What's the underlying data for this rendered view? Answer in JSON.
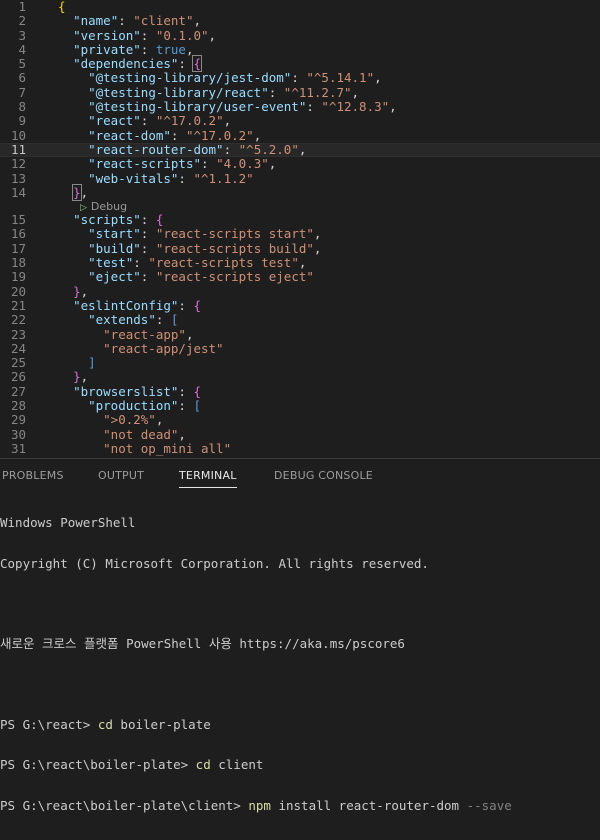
{
  "editor": {
    "codelens": "Debug",
    "lines": [
      {
        "n": "1",
        "parts": [
          {
            "t": "{",
            "c": "y"
          }
        ]
      },
      {
        "n": "2",
        "parts": [
          {
            "t": "  "
          },
          {
            "t": "\"name\"",
            "c": "k"
          },
          {
            "t": ": "
          },
          {
            "t": "\"client\"",
            "c": "s"
          },
          {
            "t": ","
          }
        ]
      },
      {
        "n": "3",
        "parts": [
          {
            "t": "  "
          },
          {
            "t": "\"version\"",
            "c": "k"
          },
          {
            "t": ": "
          },
          {
            "t": "\"0.1.0\"",
            "c": "s"
          },
          {
            "t": ","
          }
        ]
      },
      {
        "n": "4",
        "parts": [
          {
            "t": "  "
          },
          {
            "t": "\"private\"",
            "c": "k"
          },
          {
            "t": ": "
          },
          {
            "t": "true",
            "c": "b"
          },
          {
            "t": ","
          }
        ]
      },
      {
        "n": "5",
        "parts": [
          {
            "t": "  "
          },
          {
            "t": "\"dependencies\"",
            "c": "k"
          },
          {
            "t": ": "
          },
          {
            "t": "{",
            "c": "m",
            "hl": true
          }
        ]
      },
      {
        "n": "6",
        "parts": [
          {
            "t": "    "
          },
          {
            "t": "\"@testing-library/jest-dom\"",
            "c": "k"
          },
          {
            "t": ": "
          },
          {
            "t": "\"^5.14.1\"",
            "c": "s"
          },
          {
            "t": ","
          }
        ]
      },
      {
        "n": "7",
        "parts": [
          {
            "t": "    "
          },
          {
            "t": "\"@testing-library/react\"",
            "c": "k"
          },
          {
            "t": ": "
          },
          {
            "t": "\"^11.2.7\"",
            "c": "s"
          },
          {
            "t": ","
          }
        ]
      },
      {
        "n": "8",
        "parts": [
          {
            "t": "    "
          },
          {
            "t": "\"@testing-library/user-event\"",
            "c": "k"
          },
          {
            "t": ": "
          },
          {
            "t": "\"^12.8.3\"",
            "c": "s"
          },
          {
            "t": ","
          }
        ]
      },
      {
        "n": "9",
        "parts": [
          {
            "t": "    "
          },
          {
            "t": "\"react\"",
            "c": "k"
          },
          {
            "t": ": "
          },
          {
            "t": "\"^17.0.2\"",
            "c": "s"
          },
          {
            "t": ","
          }
        ]
      },
      {
        "n": "10",
        "parts": [
          {
            "t": "    "
          },
          {
            "t": "\"react-dom\"",
            "c": "k"
          },
          {
            "t": ": "
          },
          {
            "t": "\"^17.0.2\"",
            "c": "s"
          },
          {
            "t": ","
          }
        ]
      },
      {
        "n": "11",
        "current": true,
        "parts": [
          {
            "t": "    "
          },
          {
            "t": "\"react-router-dom\"",
            "c": "k"
          },
          {
            "t": ": "
          },
          {
            "t": "\"^5.2.0\"",
            "c": "s"
          },
          {
            "t": ","
          }
        ]
      },
      {
        "n": "12",
        "parts": [
          {
            "t": "    "
          },
          {
            "t": "\"react-scripts\"",
            "c": "k"
          },
          {
            "t": ": "
          },
          {
            "t": "\"4.0.3\"",
            "c": "s"
          },
          {
            "t": ","
          }
        ]
      },
      {
        "n": "13",
        "parts": [
          {
            "t": "    "
          },
          {
            "t": "\"web-vitals\"",
            "c": "k"
          },
          {
            "t": ": "
          },
          {
            "t": "\"^1.1.2\"",
            "c": "s"
          }
        ]
      },
      {
        "n": "14",
        "parts": [
          {
            "t": "  "
          },
          {
            "t": "}",
            "c": "m",
            "hl": true
          },
          {
            "t": ","
          }
        ]
      },
      {
        "codelens": true
      },
      {
        "n": "15",
        "parts": [
          {
            "t": "  "
          },
          {
            "t": "\"scripts\"",
            "c": "k"
          },
          {
            "t": ": "
          },
          {
            "t": "{",
            "c": "m"
          }
        ]
      },
      {
        "n": "16",
        "parts": [
          {
            "t": "    "
          },
          {
            "t": "\"start\"",
            "c": "k"
          },
          {
            "t": ": "
          },
          {
            "t": "\"react-scripts start\"",
            "c": "s"
          },
          {
            "t": ","
          }
        ]
      },
      {
        "n": "17",
        "parts": [
          {
            "t": "    "
          },
          {
            "t": "\"build\"",
            "c": "k"
          },
          {
            "t": ": "
          },
          {
            "t": "\"react-scripts build\"",
            "c": "s"
          },
          {
            "t": ","
          }
        ]
      },
      {
        "n": "18",
        "parts": [
          {
            "t": "    "
          },
          {
            "t": "\"test\"",
            "c": "k"
          },
          {
            "t": ": "
          },
          {
            "t": "\"react-scripts test\"",
            "c": "s"
          },
          {
            "t": ","
          }
        ]
      },
      {
        "n": "19",
        "parts": [
          {
            "t": "    "
          },
          {
            "t": "\"eject\"",
            "c": "k"
          },
          {
            "t": ": "
          },
          {
            "t": "\"react-scripts eject\"",
            "c": "s"
          }
        ]
      },
      {
        "n": "20",
        "parts": [
          {
            "t": "  "
          },
          {
            "t": "}",
            "c": "m"
          },
          {
            "t": ","
          }
        ]
      },
      {
        "n": "21",
        "parts": [
          {
            "t": "  "
          },
          {
            "t": "\"eslintConfig\"",
            "c": "k"
          },
          {
            "t": ": "
          },
          {
            "t": "{",
            "c": "m"
          }
        ]
      },
      {
        "n": "22",
        "parts": [
          {
            "t": "    "
          },
          {
            "t": "\"extends\"",
            "c": "k"
          },
          {
            "t": ": "
          },
          {
            "t": "[",
            "c": "b"
          }
        ]
      },
      {
        "n": "23",
        "parts": [
          {
            "t": "      "
          },
          {
            "t": "\"react-app\"",
            "c": "s"
          },
          {
            "t": ","
          }
        ]
      },
      {
        "n": "24",
        "parts": [
          {
            "t": "      "
          },
          {
            "t": "\"react-app/jest\"",
            "c": "s"
          }
        ]
      },
      {
        "n": "25",
        "parts": [
          {
            "t": "    "
          },
          {
            "t": "]",
            "c": "b"
          }
        ]
      },
      {
        "n": "26",
        "parts": [
          {
            "t": "  "
          },
          {
            "t": "}",
            "c": "m"
          },
          {
            "t": ","
          }
        ]
      },
      {
        "n": "27",
        "parts": [
          {
            "t": "  "
          },
          {
            "t": "\"browserslist\"",
            "c": "k"
          },
          {
            "t": ": "
          },
          {
            "t": "{",
            "c": "m"
          }
        ]
      },
      {
        "n": "28",
        "parts": [
          {
            "t": "    "
          },
          {
            "t": "\"production\"",
            "c": "k"
          },
          {
            "t": ": "
          },
          {
            "t": "[",
            "c": "b"
          }
        ]
      },
      {
        "n": "29",
        "parts": [
          {
            "t": "      "
          },
          {
            "t": "\">0.2%\"",
            "c": "s"
          },
          {
            "t": ","
          }
        ]
      },
      {
        "n": "30",
        "parts": [
          {
            "t": "      "
          },
          {
            "t": "\"not dead\"",
            "c": "s"
          },
          {
            "t": ","
          }
        ]
      },
      {
        "n": "31",
        "parts": [
          {
            "t": "      "
          },
          {
            "t": "\"not op_mini all\"",
            "c": "s"
          }
        ]
      }
    ]
  },
  "panel": {
    "tabs": [
      {
        "label": "PROBLEMS",
        "active": false
      },
      {
        "label": "OUTPUT",
        "active": false
      },
      {
        "label": "TERMINAL",
        "active": true
      },
      {
        "label": "DEBUG CONSOLE",
        "active": false
      }
    ],
    "terminal": {
      "header1": "Windows PowerShell",
      "header2": "Copyright (C) Microsoft Corporation. All rights reserved.",
      "header3": "새로운 크로스 플랫폼 PowerShell 사용 https://aka.ms/pscore6",
      "cmd1_prompt": "PS G:\\react> ",
      "cmd1_cmd": "cd",
      "cmd1_arg": " boiler-plate",
      "cmd2_prompt": "PS G:\\react\\boiler-plate> ",
      "cmd2_cmd": "cd",
      "cmd2_arg": " client",
      "cmd3_prompt": "PS G:\\react\\boiler-plate\\client> ",
      "cmd3_cmd": "npm",
      "cmd3_arg": " install react-router-dom ",
      "cmd3_flag": "--save"
    }
  },
  "colors": {
    "background": "#1e1e1e",
    "key": "#9cdcfe",
    "string": "#ce9178",
    "keyword": "#569cd6",
    "bracket_gold": "#ffd700",
    "bracket_purple": "#da70d6"
  }
}
